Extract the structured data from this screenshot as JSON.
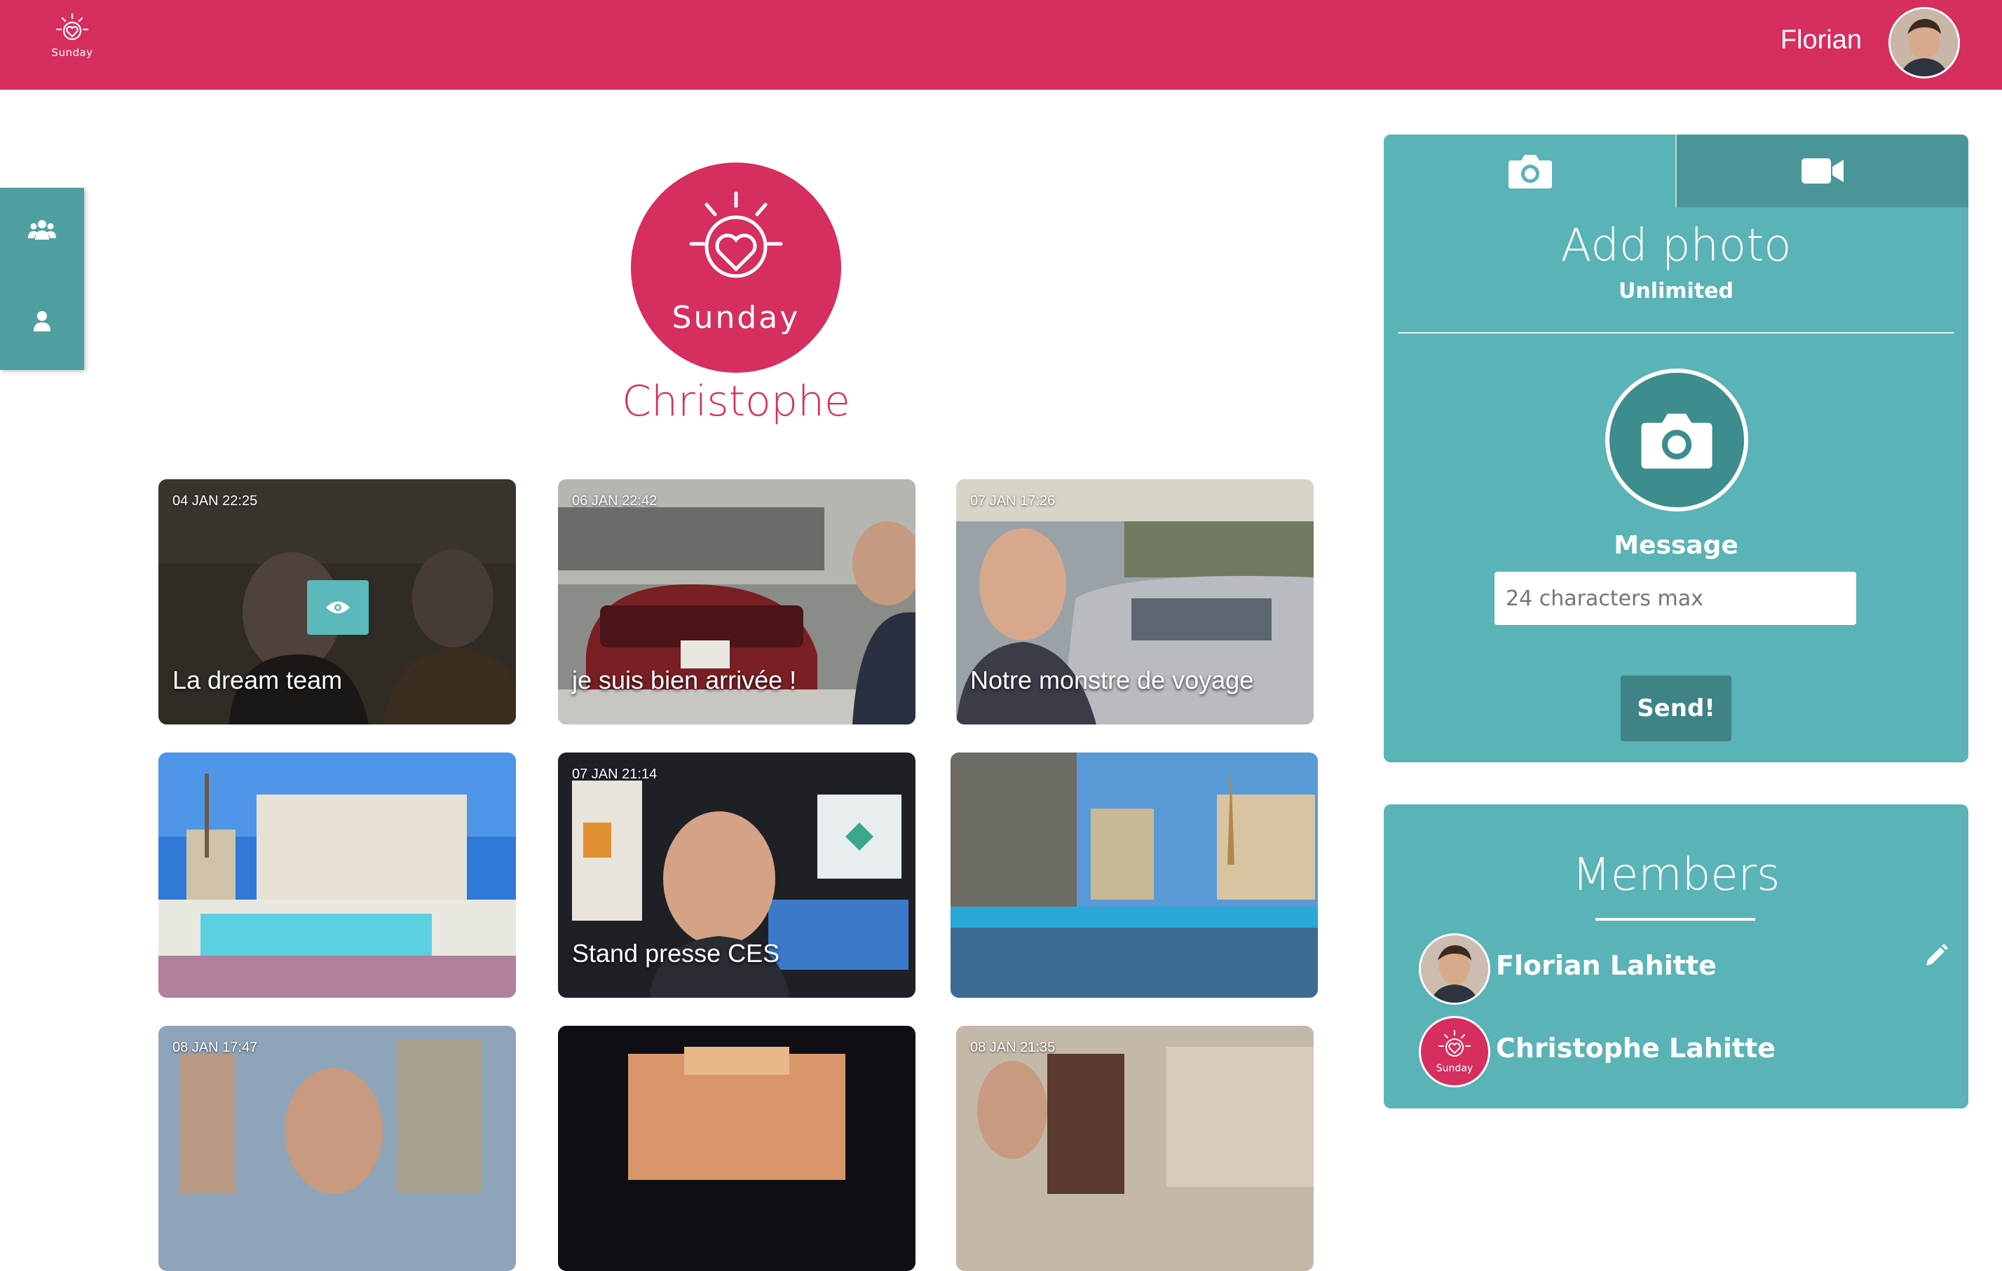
{
  "header": {
    "app_name": "Sunday",
    "user_name": "Florian",
    "brand_color": "#d62e5e"
  },
  "side_dock": {
    "items": [
      {
        "icon": "group-icon"
      },
      {
        "icon": "user-icon"
      }
    ]
  },
  "profile": {
    "logo_text": "Sunday",
    "name": "Christophe"
  },
  "photos": [
    {
      "date": "04 JAN 22:25",
      "caption": "La dream team"
    },
    {
      "date": "06 JAN 22:42",
      "caption": "je suis bien arrivée !"
    },
    {
      "date": "07 JAN 17:26",
      "caption": "Notre monstre de voyage"
    },
    {
      "date": "",
      "caption": ""
    },
    {
      "date": "07 JAN 21:14",
      "caption": "Stand presse CES"
    },
    {
      "date": "",
      "caption": ""
    },
    {
      "date": "08 JAN 17:47",
      "caption": ""
    },
    {
      "date": "",
      "caption": ""
    },
    {
      "date": "08 JAN 21:35",
      "caption": ""
    }
  ],
  "add_panel": {
    "title": "Add photo",
    "subtitle": "Unlimited",
    "message_label": "Message",
    "message_placeholder": "24 characters max",
    "send_label": "Send!",
    "accent_color": "#5ab3b6"
  },
  "members_panel": {
    "title": "Members",
    "members": [
      {
        "name": "Florian Lahitte"
      },
      {
        "name": "Christophe Lahitte",
        "avatar_text": "Sunday"
      }
    ]
  }
}
